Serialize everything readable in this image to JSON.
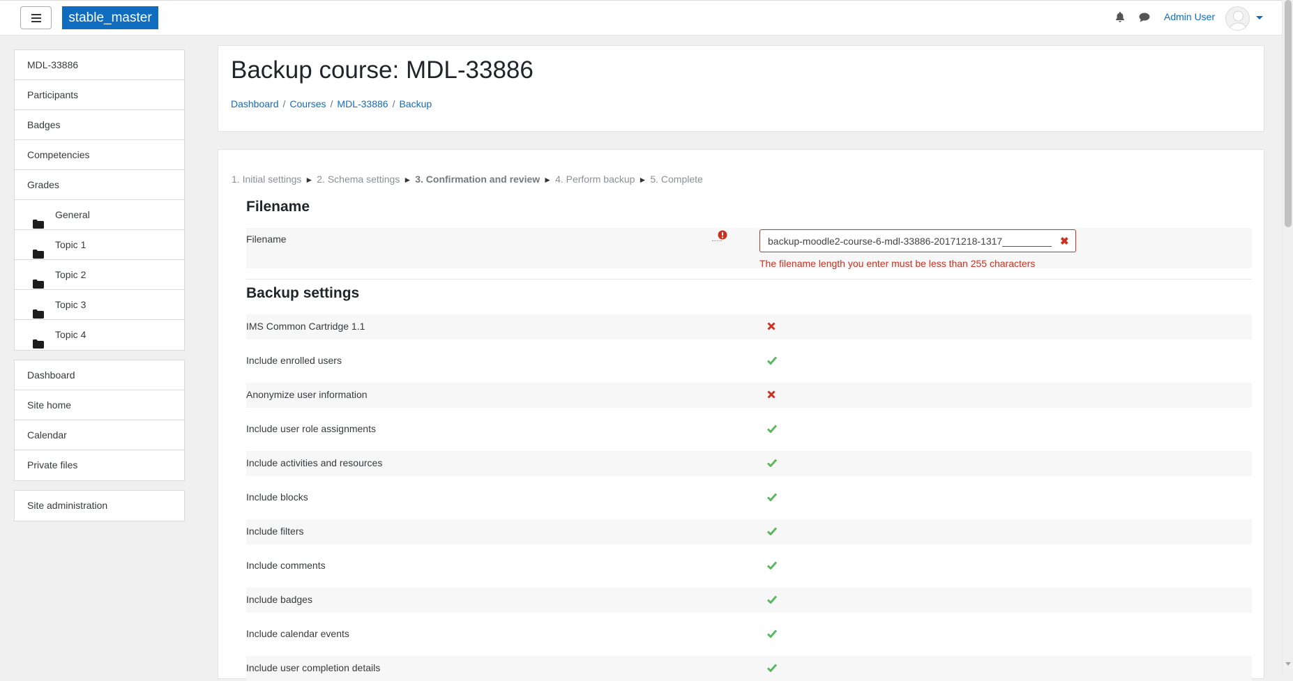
{
  "navbar": {
    "brand": "stable_master",
    "user_name": "Admin User",
    "icons": [
      "hamburger-icon",
      "bell-icon",
      "chat-icon",
      "avatar",
      "caret-down-icon"
    ]
  },
  "sidebar": {
    "course_nav": [
      {
        "label": "MDL-33886"
      },
      {
        "label": "Participants"
      },
      {
        "label": "Badges"
      },
      {
        "label": "Competencies"
      },
      {
        "label": "Grades"
      },
      {
        "label": "General",
        "icon": "folder-icon"
      },
      {
        "label": "Topic 1",
        "icon": "folder-icon"
      },
      {
        "label": "Topic 2",
        "icon": "folder-icon"
      },
      {
        "label": "Topic 3",
        "icon": "folder-icon"
      },
      {
        "label": "Topic 4",
        "icon": "folder-icon"
      }
    ],
    "site_nav": [
      {
        "label": "Dashboard"
      },
      {
        "label": "Site home"
      },
      {
        "label": "Calendar"
      },
      {
        "label": "Private files"
      }
    ],
    "admin_nav": [
      {
        "label": "Site administration"
      }
    ]
  },
  "header": {
    "title": "Backup course: MDL-33886",
    "breadcrumb": [
      "Dashboard",
      "Courses",
      "MDL-33886",
      "Backup"
    ]
  },
  "stages": {
    "s1": "1. Initial settings",
    "s2": "2. Schema settings",
    "s3": "3. Confirmation and review",
    "s4": "4. Perform backup",
    "s5": "5. Complete",
    "separator": "►"
  },
  "filename_section": {
    "title": "Filename",
    "label": "Filename",
    "value": "backup-moodle2-course-6-mdl-33886-20171218-1317__________",
    "error": "The filename length you enter must be less than 255 characters"
  },
  "backup_settings": {
    "title": "Backup settings",
    "items": [
      {
        "label": "IMS Common Cartridge 1.1",
        "enabled": false
      },
      {
        "label": "Include enrolled users",
        "enabled": true
      },
      {
        "label": "Anonymize user information",
        "enabled": false
      },
      {
        "label": "Include user role assignments",
        "enabled": true
      },
      {
        "label": "Include activities and resources",
        "enabled": true
      },
      {
        "label": "Include blocks",
        "enabled": true
      },
      {
        "label": "Include filters",
        "enabled": true
      },
      {
        "label": "Include comments",
        "enabled": true
      },
      {
        "label": "Include badges",
        "enabled": true
      },
      {
        "label": "Include calendar events",
        "enabled": true
      },
      {
        "label": "Include user completion details",
        "enabled": true
      }
    ]
  },
  "colors": {
    "brand": "#0f6cbf",
    "error": "#ca3120",
    "success": "#5cb85c"
  }
}
